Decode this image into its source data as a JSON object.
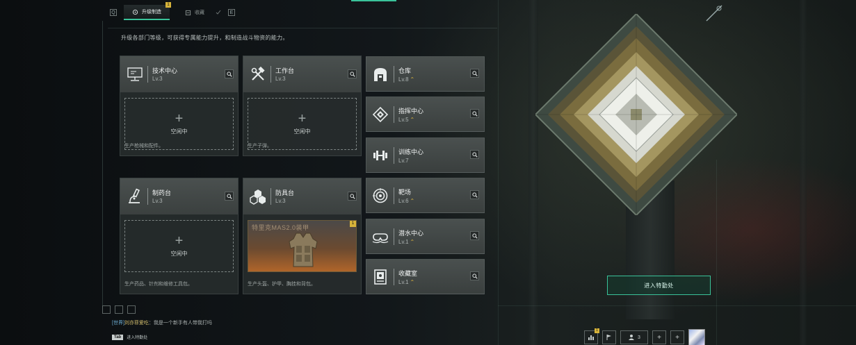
{
  "nav": {
    "left_key": "Q",
    "right_key": "E",
    "tabs": [
      {
        "label": "升级制造",
        "active": true,
        "badge": "1"
      },
      {
        "label": "收藏",
        "active": false
      }
    ]
  },
  "description": "升级各部门等级，可获得专属能力提升，和制造战斗物资的能力。",
  "production_cards": [
    {
      "name": "技术中心",
      "level": "Lv.3",
      "icon": "computer-icon",
      "slot": "空闲中",
      "footer": "生产枪械和配件。"
    },
    {
      "name": "工作台",
      "level": "Lv.3",
      "icon": "hammer-wrench-icon",
      "slot": "空闲中",
      "footer": "生产子弹。"
    },
    {
      "name": "制药台",
      "level": "Lv.3",
      "icon": "microscope-icon",
      "slot": "空闲中",
      "footer": "生产药品、针剂和维修工具包。"
    },
    {
      "name": "防具台",
      "level": "Lv.3",
      "icon": "armor-parts-icon",
      "slot_item": "特里克MAS2.0装甲",
      "slot_badge": "1",
      "footer": "生产头盔、护甲、胸挂和背包。"
    }
  ],
  "side_cards": [
    {
      "name": "仓库",
      "level": "Lv.8",
      "upgradable": true,
      "icon": "warehouse-icon"
    },
    {
      "name": "指挥中心",
      "level": "Lv.5",
      "upgradable": true,
      "icon": "command-diamond-icon"
    },
    {
      "name": "训练中心",
      "level": "Lv.7",
      "upgradable": false,
      "icon": "dumbbell-icon"
    },
    {
      "name": "靶场",
      "level": "Lv.6",
      "upgradable": true,
      "icon": "target-icon"
    },
    {
      "name": "潜水中心",
      "level": "Lv.1",
      "upgradable": true,
      "icon": "goggles-icon"
    },
    {
      "name": "收藏室",
      "level": "Lv.1",
      "upgradable": true,
      "icon": "display-case-icon"
    }
  ],
  "up_symbol": "⌃",
  "enter_button": "进入特勤处",
  "chat": {
    "channel": "[世界]",
    "user": "刘亦菲爱吃",
    "message": "：我是一个新手有人带我打吗"
  },
  "tab_hint": {
    "key": "Tab",
    "label": "进入特勤处"
  },
  "bottom_bar": {
    "rank_badge": "1",
    "friends_count": "3"
  },
  "colors": {
    "accent": "#3ac39a",
    "upgrade": "#e2b93d",
    "badge": "#d6b33a"
  }
}
